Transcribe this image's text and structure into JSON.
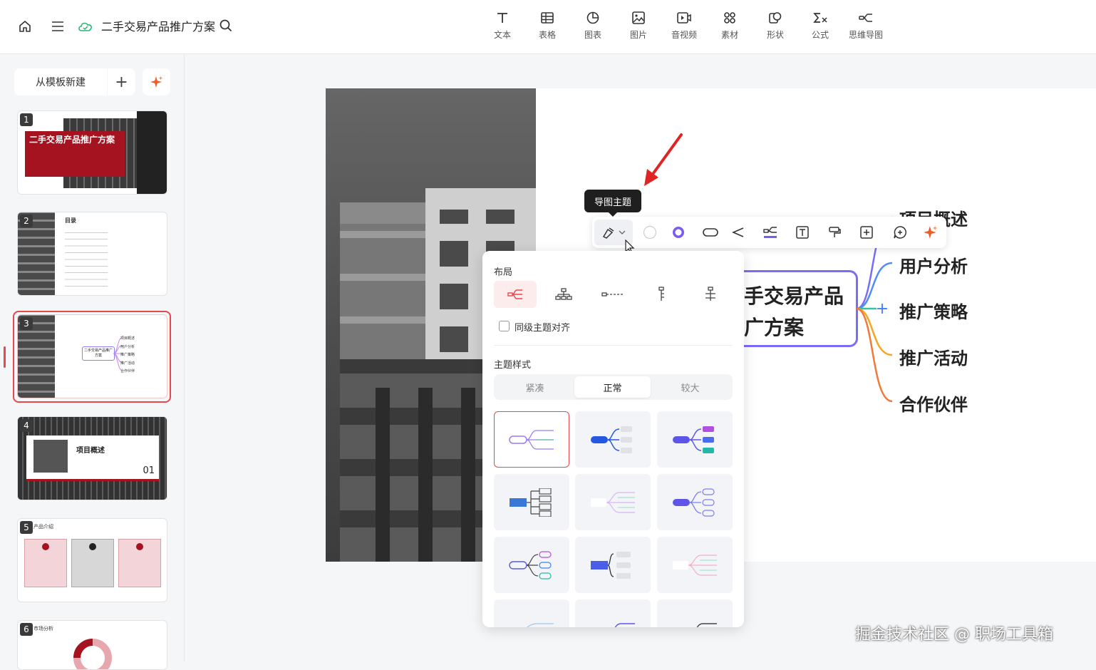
{
  "header": {
    "title": "二手交易产品推广方案"
  },
  "toolbar": [
    {
      "label": "文本",
      "icon": "text-icon"
    },
    {
      "label": "表格",
      "icon": "table-icon"
    },
    {
      "label": "图表",
      "icon": "chart-icon"
    },
    {
      "label": "图片",
      "icon": "image-icon"
    },
    {
      "label": "音视频",
      "icon": "video-icon"
    },
    {
      "label": "素材",
      "icon": "material-icon"
    },
    {
      "label": "形状",
      "icon": "shape-icon"
    },
    {
      "label": "公式",
      "icon": "formula-icon"
    },
    {
      "label": "思维导图",
      "icon": "mindmap-icon"
    }
  ],
  "sidebar": {
    "template_button": "从模板新建",
    "add_button": "+",
    "slides": [
      {
        "num": "1",
        "title": "二手交易产品推广方案"
      },
      {
        "num": "2",
        "title": "目录"
      },
      {
        "num": "3",
        "center": "二手交易产品推广方案",
        "items": [
          "项目概述",
          "用户分析",
          "推广策略",
          "推广活动",
          "合作伙伴"
        ]
      },
      {
        "num": "4",
        "title": "项目概述",
        "page": "01"
      },
      {
        "num": "5",
        "title": "产品介绍"
      },
      {
        "num": "6",
        "title": "市场分析"
      }
    ]
  },
  "canvas": {
    "center_line1": "手交易产品",
    "center_line2": "广方案",
    "branches": [
      "项目概述",
      "用户分析",
      "推广策略",
      "推广活动",
      "合作伙伴"
    ]
  },
  "tooltip": "导图主题",
  "popup": {
    "layout_title": "布局",
    "align_label": "同级主题对齐",
    "style_title": "主题样式",
    "segments": [
      "紧凑",
      "正常",
      "较大"
    ],
    "selected_segment": "正常"
  },
  "watermark": "掘金技术社区 @ 职场工具箱",
  "colors": {
    "accent": "#e5484d",
    "mindmap_purple": "#7b6cf6",
    "slide_red": "#a51220"
  }
}
